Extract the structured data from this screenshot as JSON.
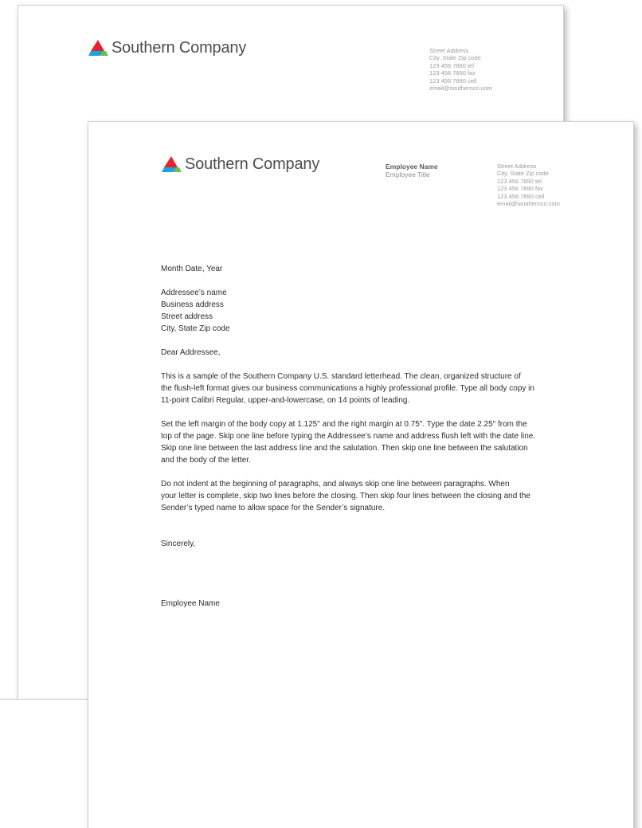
{
  "brand": {
    "company_name": "Southern Company",
    "logo_colors": {
      "red": "#e4242b",
      "blue": "#1ca2de",
      "green": "#6ebe4a"
    }
  },
  "contact": {
    "street": "Street Address",
    "city": "City, State Zip code",
    "tel": "123 456 7890 tel",
    "fax": "123 456 7890 fax",
    "cell": "123 456 7890 cell",
    "email": "email@southernco.com"
  },
  "sender": {
    "name": "Employee Name",
    "title": "Employee Title"
  },
  "letter": {
    "date": "Month Date, Year",
    "addressee": {
      "name": "Addressee’s name",
      "business": "Business address",
      "street": "Street address",
      "city": "City, State Zip code"
    },
    "salutation": "Dear Addressee,",
    "paragraphs": [
      [
        "This is a sample of the Southern Company U.S. standard letterhead. The clean, organized structure of",
        "the flush-left format gives our business communications a highly professional profile. Type all body copy in",
        "11-point Calibri Regular, upper-and-lowercase, on 14 points of leading."
      ],
      [
        "Set the left margin of the body copy at 1.125\" and the right margin at 0.75\". Type the date 2.25\" from the",
        "top of the page. Skip one line before typing the Addressee’s name and address flush left with the date line.",
        "Skip one line between the last address line and the salutation. Then skip one line between the salutation",
        "and the body of the letter."
      ],
      [
        "Do not indent at the beginning of paragraphs, and always skip one line between paragraphs. When",
        "your letter is complete, skip two lines before the closing. Then skip four lines between the closing and the",
        "Sender’s typed name to allow space for the Sender’s signature."
      ]
    ],
    "closing": "Sincerely,",
    "signature_name": "Employee Name"
  }
}
